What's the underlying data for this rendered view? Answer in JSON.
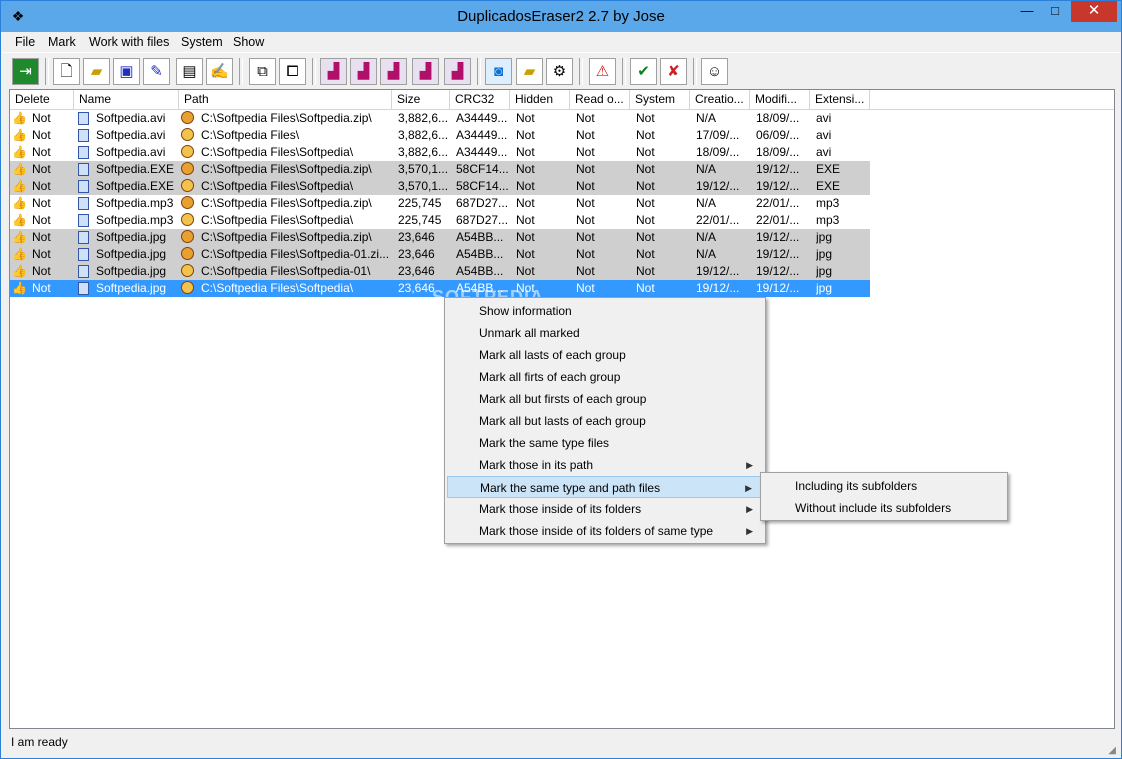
{
  "window": {
    "title": "DuplicadosEraser2 2.7 by Jose",
    "minimize": "—",
    "maximize": "□",
    "close": "✕"
  },
  "menu": [
    "File",
    "Mark",
    "Work with files",
    "System",
    "Show"
  ],
  "columns": [
    "Delete",
    "Name",
    "Path",
    "Size",
    "CRC32",
    "Hidden",
    "Read o...",
    "System",
    "Creatio...",
    "Modifi...",
    "Extensi..."
  ],
  "rows": [
    {
      "del": "Not",
      "name": "Softpedia.avi",
      "path": "C:\\Softpedia Files\\Softpedia.zip\\",
      "size": "3,882,6...",
      "crc": "A34449...",
      "hidden": "Not",
      "ro": "Not",
      "sys": "Not",
      "created": "N/A",
      "modified": "18/09/...",
      "ext": "avi",
      "style": "white",
      "pathicon": "zip"
    },
    {
      "del": "Not",
      "name": "Softpedia.avi",
      "path": "C:\\Softpedia Files\\",
      "size": "3,882,6...",
      "crc": "A34449...",
      "hidden": "Not",
      "ro": "Not",
      "sys": "Not",
      "created": "17/09/...",
      "modified": "06/09/...",
      "ext": "avi",
      "style": "white",
      "pathicon": "folder"
    },
    {
      "del": "Not",
      "name": "Softpedia.avi",
      "path": "C:\\Softpedia Files\\Softpedia\\",
      "size": "3,882,6...",
      "crc": "A34449...",
      "hidden": "Not",
      "ro": "Not",
      "sys": "Not",
      "created": "18/09/...",
      "modified": "18/09/...",
      "ext": "avi",
      "style": "white",
      "pathicon": "folder"
    },
    {
      "del": "Not",
      "name": "Softpedia.EXE",
      "path": "C:\\Softpedia Files\\Softpedia.zip\\",
      "size": "3,570,1...",
      "crc": "58CF14...",
      "hidden": "Not",
      "ro": "Not",
      "sys": "Not",
      "created": "N/A",
      "modified": "19/12/...",
      "ext": "EXE",
      "style": "gray",
      "pathicon": "zip"
    },
    {
      "del": "Not",
      "name": "Softpedia.EXE",
      "path": "C:\\Softpedia Files\\Softpedia\\",
      "size": "3,570,1...",
      "crc": "58CF14...",
      "hidden": "Not",
      "ro": "Not",
      "sys": "Not",
      "created": "19/12/...",
      "modified": "19/12/...",
      "ext": "EXE",
      "style": "gray",
      "pathicon": "folder"
    },
    {
      "del": "Not",
      "name": "Softpedia.mp3",
      "path": "C:\\Softpedia Files\\Softpedia.zip\\",
      "size": "225,745",
      "crc": "687D27...",
      "hidden": "Not",
      "ro": "Not",
      "sys": "Not",
      "created": "N/A",
      "modified": "22/01/...",
      "ext": "mp3",
      "style": "white",
      "pathicon": "zip"
    },
    {
      "del": "Not",
      "name": "Softpedia.mp3",
      "path": "C:\\Softpedia Files\\Softpedia\\",
      "size": "225,745",
      "crc": "687D27...",
      "hidden": "Not",
      "ro": "Not",
      "sys": "Not",
      "created": "22/01/...",
      "modified": "22/01/...",
      "ext": "mp3",
      "style": "white",
      "pathicon": "folder"
    },
    {
      "del": "Not",
      "name": "Softpedia.jpg",
      "path": "C:\\Softpedia Files\\Softpedia.zip\\",
      "size": "23,646",
      "crc": "A54BB...",
      "hidden": "Not",
      "ro": "Not",
      "sys": "Not",
      "created": "N/A",
      "modified": "19/12/...",
      "ext": "jpg",
      "style": "gray",
      "pathicon": "zip"
    },
    {
      "del": "Not",
      "name": "Softpedia.jpg",
      "path": "C:\\Softpedia Files\\Softpedia-01.zi...",
      "size": "23,646",
      "crc": "A54BB...",
      "hidden": "Not",
      "ro": "Not",
      "sys": "Not",
      "created": "N/A",
      "modified": "19/12/...",
      "ext": "jpg",
      "style": "gray",
      "pathicon": "zip"
    },
    {
      "del": "Not",
      "name": "Softpedia.jpg",
      "path": "C:\\Softpedia Files\\Softpedia-01\\",
      "size": "23,646",
      "crc": "A54BB...",
      "hidden": "Not",
      "ro": "Not",
      "sys": "Not",
      "created": "19/12/...",
      "modified": "19/12/...",
      "ext": "jpg",
      "style": "gray",
      "pathicon": "folder"
    },
    {
      "del": "Not",
      "name": "Softpedia.jpg",
      "path": "C:\\Softpedia Files\\Softpedia\\",
      "size": "23,646",
      "crc": "A54BB...",
      "hidden": "Not",
      "ro": "Not",
      "sys": "Not",
      "created": "19/12/...",
      "modified": "19/12/...",
      "ext": "jpg",
      "style": "sel",
      "pathicon": "folder"
    }
  ],
  "context_menu": [
    {
      "label": "Show information",
      "submenu": false
    },
    {
      "label": "Unmark all marked",
      "submenu": false
    },
    {
      "label": "Mark all lasts of each group",
      "submenu": false
    },
    {
      "label": "Mark all firts of each group",
      "submenu": false
    },
    {
      "label": "Mark all but firsts of each group",
      "submenu": false
    },
    {
      "label": "Mark all but lasts of each group",
      "submenu": false
    },
    {
      "label": "Mark the same type files",
      "submenu": false
    },
    {
      "label": "Mark those in its path",
      "submenu": true
    },
    {
      "label": "Mark the same type and path files",
      "submenu": true,
      "highlight": true
    },
    {
      "label": "Mark those inside of its folders",
      "submenu": true
    },
    {
      "label": "Mark those inside of its folders of same type",
      "submenu": true
    }
  ],
  "submenu": [
    "Including its subfolders",
    "Without include its subfolders"
  ],
  "status": "I am ready",
  "watermark": "SOFTPEDIA",
  "colors": {
    "selection": "#3399ff",
    "group_gray": "#cfcfcf",
    "menu_highlight": "#cce4f7",
    "titlebar": "#5aa7ea"
  }
}
